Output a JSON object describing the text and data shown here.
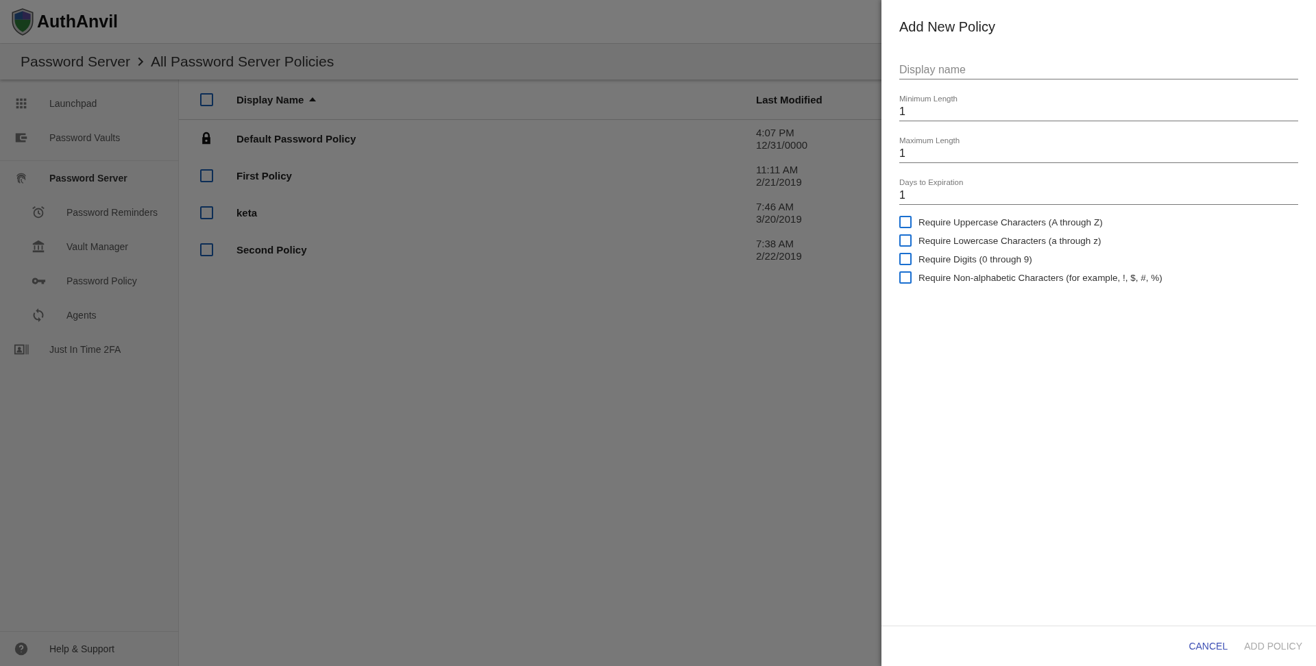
{
  "app": {
    "logo_text": "AuthAnvil"
  },
  "breadcrumb": [
    "Password Server",
    "All Password Server Policies"
  ],
  "sidebar": {
    "items": [
      {
        "label": "Launchpad",
        "selected": false
      },
      {
        "label": "Password Vaults",
        "selected": false
      },
      {
        "label": "Password Server",
        "selected": true,
        "children": [
          {
            "label": "Password Reminders",
            "selected": false
          },
          {
            "label": "Vault Manager",
            "selected": false
          },
          {
            "label": "Password Policy",
            "selected": false
          },
          {
            "label": "Agents",
            "selected": false
          }
        ]
      },
      {
        "label": "Just In Time 2FA",
        "selected": false
      }
    ],
    "footer": {
      "label": "Help & Support"
    }
  },
  "table": {
    "columns": [
      {
        "label": "Display Name",
        "sorted": true
      },
      {
        "label": "Last Modified",
        "sorted": false
      }
    ],
    "select_all_checked": false,
    "rows": [
      {
        "name": "Default Password Policy",
        "locked": true,
        "time": "4:07 PM",
        "date": "12/31/0000"
      },
      {
        "name": "First Policy",
        "locked": false,
        "checked": false,
        "time": "11:11 AM",
        "date": "2/21/2019"
      },
      {
        "name": "keta",
        "locked": false,
        "checked": false,
        "time": "7:46 AM",
        "date": "3/20/2019"
      },
      {
        "name": "Second Policy",
        "locked": false,
        "checked": false,
        "time": "7:38 AM",
        "date": "2/22/2019"
      }
    ]
  },
  "drawer": {
    "title": "Add New Policy",
    "fields": [
      {
        "kind": "text",
        "placeholder": "Display name"
      },
      {
        "kind": "number",
        "label": "Minimum Length",
        "value": "1"
      },
      {
        "kind": "number",
        "label": "Maximum Length",
        "value": "1"
      },
      {
        "kind": "number",
        "label": "Days to Expiration",
        "value": "1"
      }
    ],
    "options": [
      {
        "label": "Require Uppercase Characters (A through Z)",
        "checked": false
      },
      {
        "label": "Require Lowercase Characters (a through z)",
        "checked": false
      },
      {
        "label": "Require Digits (0 through 9)",
        "checked": false
      },
      {
        "label": "Require Non-alphabetic Characters (for example, !, $, #, %)",
        "checked": false
      }
    ],
    "buttons": [
      {
        "label": "CANCEL",
        "disabled": false
      },
      {
        "label": "ADD POLICY",
        "disabled": true
      }
    ]
  }
}
